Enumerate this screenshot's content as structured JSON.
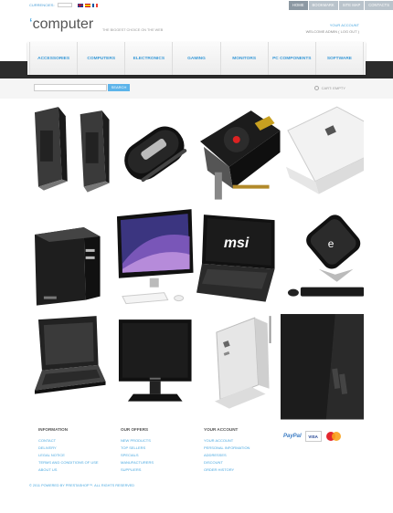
{
  "topbar": {
    "currency_label": "CURRENCIES:",
    "links": [
      {
        "label": "HOME",
        "active": true
      },
      {
        "label": "BOOKMARK",
        "active": false
      },
      {
        "label": "SITE MAP",
        "active": false
      },
      {
        "label": "CONTACTS",
        "active": false
      }
    ]
  },
  "header": {
    "logo_text": "computer",
    "tagline": "THE BIGGEST CHOICE ON THE WEB",
    "account_link": "YOUR ACCOUNT",
    "welcome": "WELCOME ADMIN ( LOG OUT )"
  },
  "nav": {
    "items": [
      "ACCESSORIES",
      "COMPUTERS",
      "ELECTRONICS",
      "GAMING",
      "MONITORS",
      "PC COMPONENTS",
      "SOFTWARE"
    ]
  },
  "search": {
    "button_label": "SEARCH",
    "cart_text": "CART: EMPTY"
  },
  "products": [
    {
      "name": "speakers"
    },
    {
      "name": "mouse"
    },
    {
      "name": "graphics-card"
    },
    {
      "name": "laptop-white"
    },
    {
      "name": "desktop-case"
    },
    {
      "name": "all-in-one-monitor"
    },
    {
      "name": "msi-laptop"
    },
    {
      "name": "nettop"
    },
    {
      "name": "tablet-laptop"
    },
    {
      "name": "lcd-monitor"
    },
    {
      "name": "mini-pc"
    },
    {
      "name": "tower-case"
    }
  ],
  "footer": {
    "columns": [
      {
        "title": "INFORMATION",
        "links": [
          "CONTACT",
          "DELIVERY",
          "LEGAL NOTICE",
          "TERMS AND CONDITIONS OF USE",
          "ABOUT US"
        ]
      },
      {
        "title": "OUR OFFERS",
        "links": [
          "NEW PRODUCTS",
          "TOP SELLERS",
          "SPECIALS",
          "MANUFACTURERS",
          "SUPPLIERS"
        ]
      },
      {
        "title": "YOUR ACCOUNT",
        "links": [
          "YOUR ACCOUNT",
          "PERSONAL INFORMATION",
          "ADDRESSES",
          "DISCOUNT",
          "ORDER HISTORY"
        ]
      }
    ],
    "payments": {
      "paypal": "PayPal",
      "visa": "VISA"
    },
    "copyright": "© 2011 POWERED BY PRESTASHOP™. ALL RIGHTS RESERVED"
  },
  "colors": {
    "accent": "#4aa8e0",
    "dark": "#2b2b2b"
  }
}
